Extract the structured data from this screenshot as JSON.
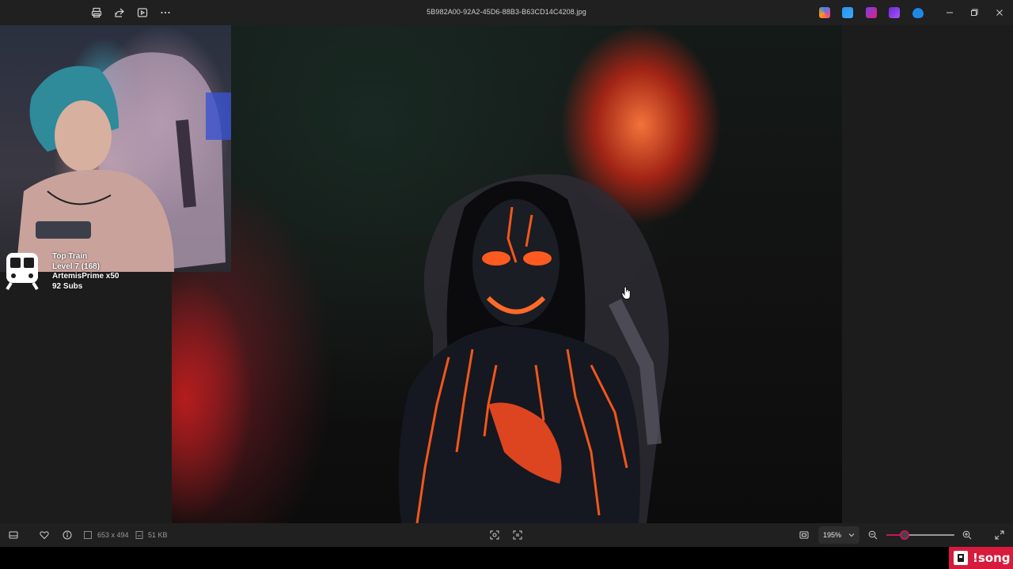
{
  "titlebar": {
    "filename": "5B982A00-92A2-45D6-88B3-B63CD14C4208.jpg"
  },
  "overlay": {
    "line1": "Top Train",
    "line2": "Level 7  (168)",
    "line3": "ArtemisPrime x50",
    "line4": "92 Subs"
  },
  "statusbar": {
    "dimensions": "653 x 494",
    "filesize": "51 KB",
    "zoom": "195%",
    "zoom_slider_fraction": 0.27
  },
  "song_badge": {
    "label": "!song"
  },
  "colors": {
    "accent": "#c2185b",
    "badge": "#d81b3c"
  }
}
